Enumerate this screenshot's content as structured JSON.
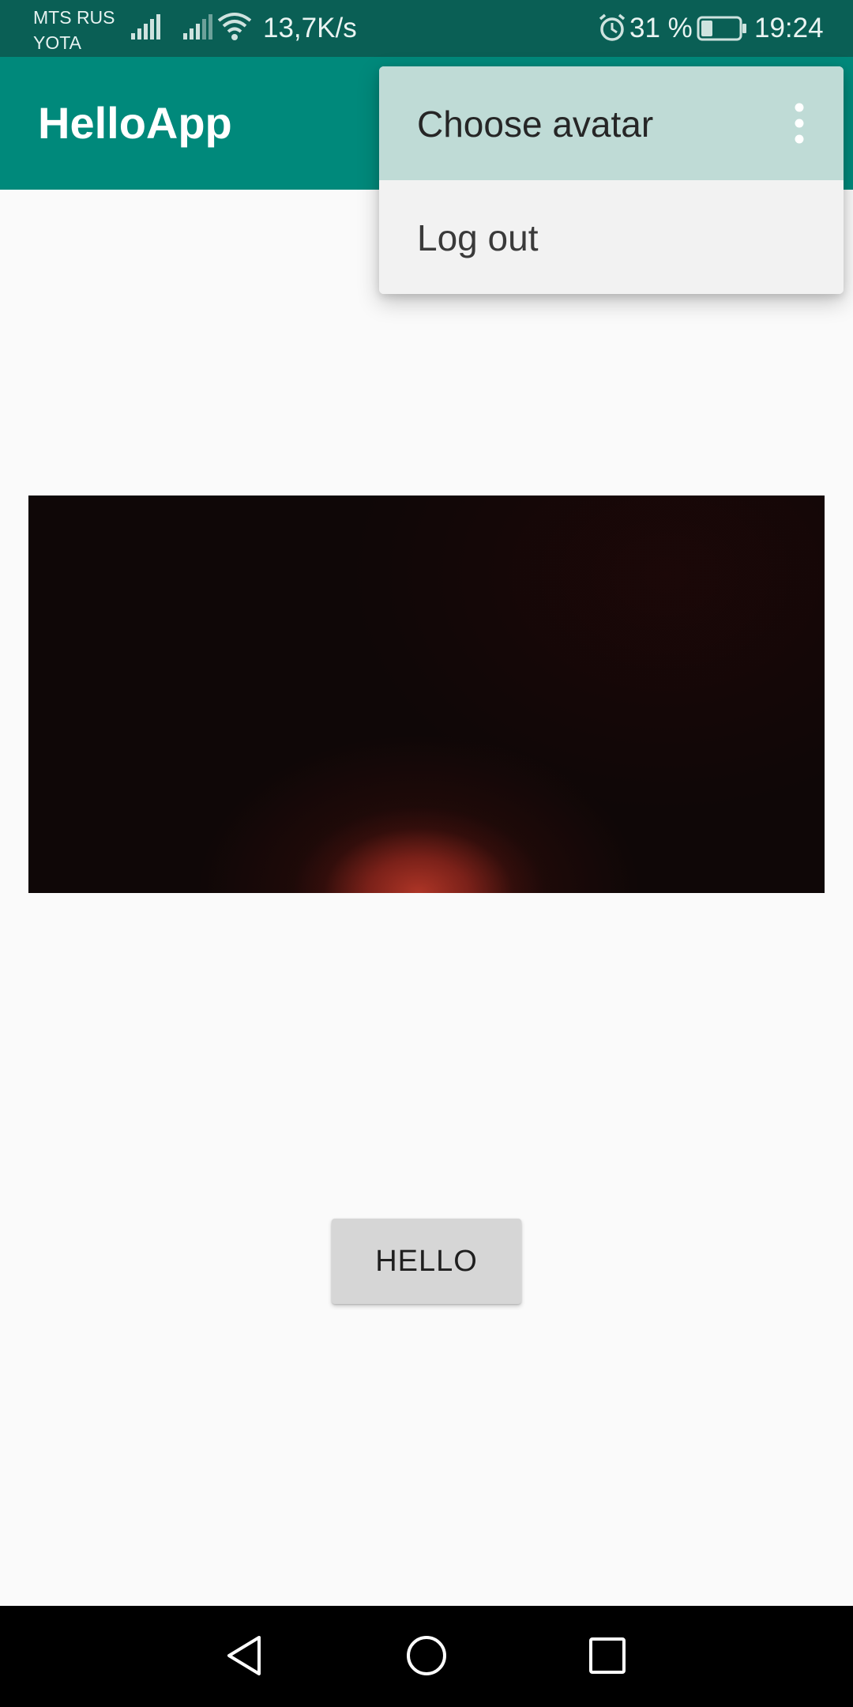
{
  "status_bar": {
    "carrier_1": "MTS RUS",
    "carrier_2": "YOTA",
    "net_speed": "13,7K/s",
    "battery_percent": "31 %",
    "battery_level": 0.31,
    "time": "19:24",
    "icons": [
      "signal-icon",
      "signal-icon",
      "wifi-icon",
      "alarm-icon",
      "battery-icon"
    ]
  },
  "app_bar": {
    "title": "HelloApp",
    "color": "#00897b"
  },
  "overflow_menu": {
    "items": [
      {
        "label": "Choose avatar",
        "highlighted": true
      },
      {
        "label": "Log out",
        "highlighted": false
      }
    ],
    "icon": "more-vert-icon"
  },
  "main": {
    "image": "avatar-image",
    "button_label": "HELLO"
  },
  "nav_bar": {
    "icons": [
      "back-icon",
      "home-icon",
      "recents-icon"
    ]
  }
}
